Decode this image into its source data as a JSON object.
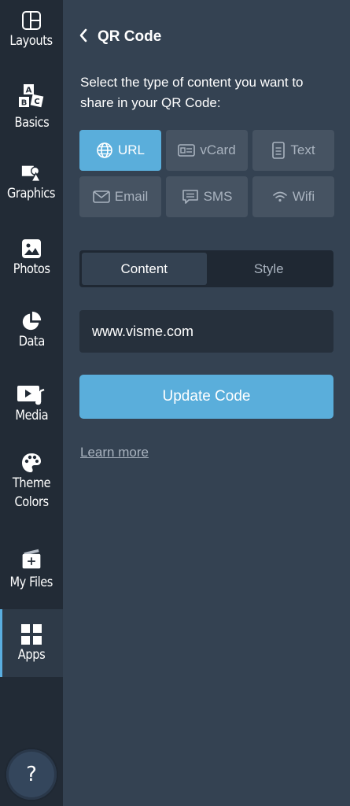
{
  "sidebar": {
    "items": [
      {
        "label": "Layouts",
        "icon": "layouts-icon"
      },
      {
        "label": "Basics",
        "icon": "abc-blocks-icon"
      },
      {
        "label": "Graphics",
        "icon": "graphics-icon"
      },
      {
        "label": "Photos",
        "icon": "photo-icon"
      },
      {
        "label": "Data",
        "icon": "pie-chart-icon"
      },
      {
        "label": "Media",
        "icon": "media-icon"
      },
      {
        "label": "Theme",
        "label2": "Colors",
        "icon": "palette-icon"
      },
      {
        "label": "My Files",
        "icon": "folder-plus-icon"
      },
      {
        "label": "Apps",
        "icon": "apps-grid-icon",
        "active": true
      }
    ],
    "help_label": "?"
  },
  "panel": {
    "title": "QR Code",
    "description": "Select the type of content you want to share in your QR Code:",
    "types": [
      {
        "label": "URL",
        "icon": "globe-icon",
        "active": true
      },
      {
        "label": "vCard",
        "icon": "id-card-icon"
      },
      {
        "label": "Text",
        "icon": "document-icon"
      },
      {
        "label": "Email",
        "icon": "envelope-icon"
      },
      {
        "label": "SMS",
        "icon": "chat-icon"
      },
      {
        "label": "Wifi",
        "icon": "wifi-icon"
      }
    ],
    "tabs": {
      "content": "Content",
      "style": "Style"
    },
    "url_value": "www.visme.com",
    "update_button": "Update Code",
    "learn_more": "Learn more"
  },
  "colors": {
    "accent": "#5aaedb",
    "sidebar_bg": "#222b36",
    "panel_bg": "#344252",
    "button_bg": "#465362",
    "muted_text": "#a9b3bf"
  }
}
